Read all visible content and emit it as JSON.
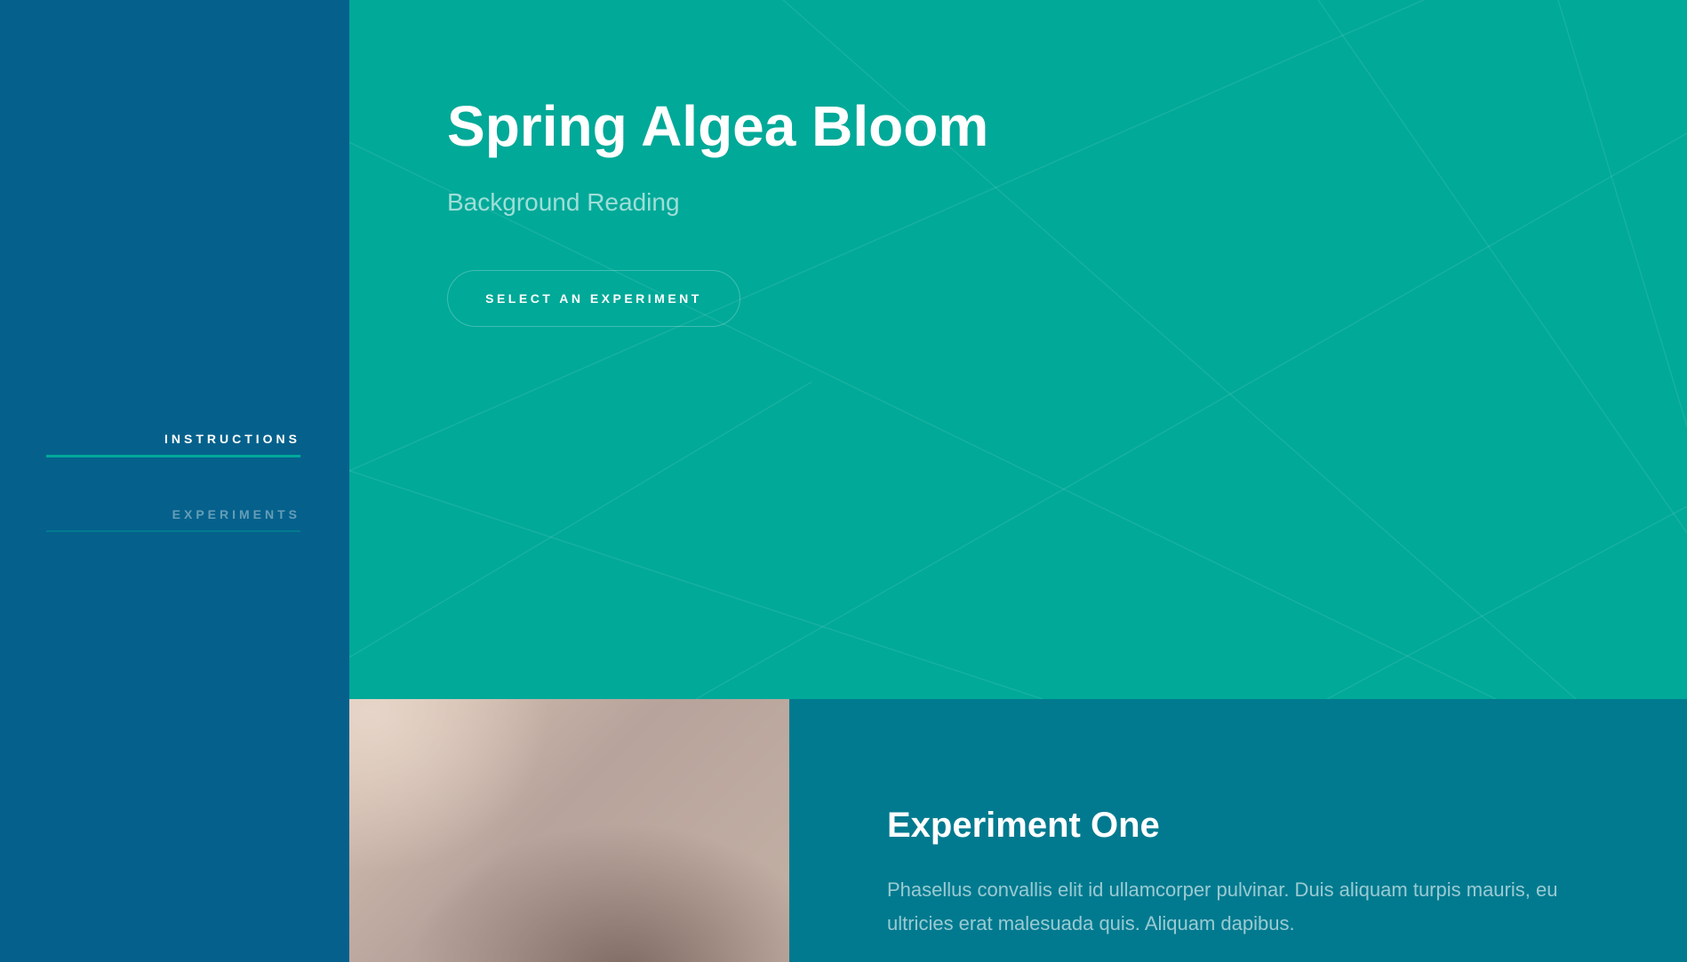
{
  "colors": {
    "sidebar": "#05618c",
    "hero": "#00a998",
    "experiment_panel": "#017a8f",
    "nav_active_underline": "#00a99a"
  },
  "sidebar": {
    "items": [
      {
        "label": "INSTRUCTIONS",
        "active": true
      },
      {
        "label": "EXPERIMENTS",
        "active": false
      }
    ]
  },
  "hero": {
    "title": "Spring Algea Bloom",
    "subtitle": "Background Reading",
    "button_label": "SELECT AN EXPERIMENT"
  },
  "experiment": {
    "title": "Experiment One",
    "description": "Phasellus convallis elit id ullamcorper pulvinar. Duis aliquam turpis mauris, eu ultricies erat malesuada quis. Aliquam dapibus."
  }
}
